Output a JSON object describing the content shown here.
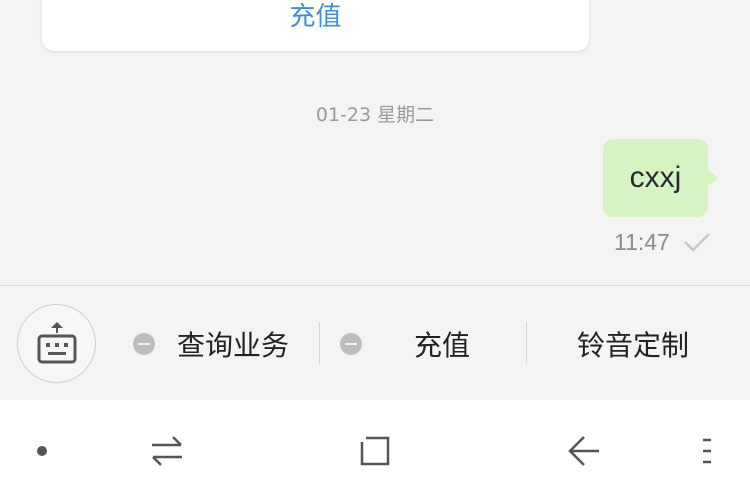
{
  "card": {
    "link_label": "充值"
  },
  "date_separator": "01-23  星期二",
  "message": {
    "text": "cxxj",
    "time": "11:47"
  },
  "menu": {
    "items": [
      {
        "label": "查询业务"
      },
      {
        "label": "充值"
      },
      {
        "label": "铃音定制"
      }
    ]
  },
  "colors": {
    "accent": "#3d8fd8",
    "bubble": "#d6f3c4",
    "background": "#f4f4f4"
  },
  "icons": {
    "keyboard": "keyboard-icon",
    "nav": [
      "dot-icon",
      "switch-icon",
      "square-icon",
      "back-icon",
      "menu-icon"
    ]
  }
}
